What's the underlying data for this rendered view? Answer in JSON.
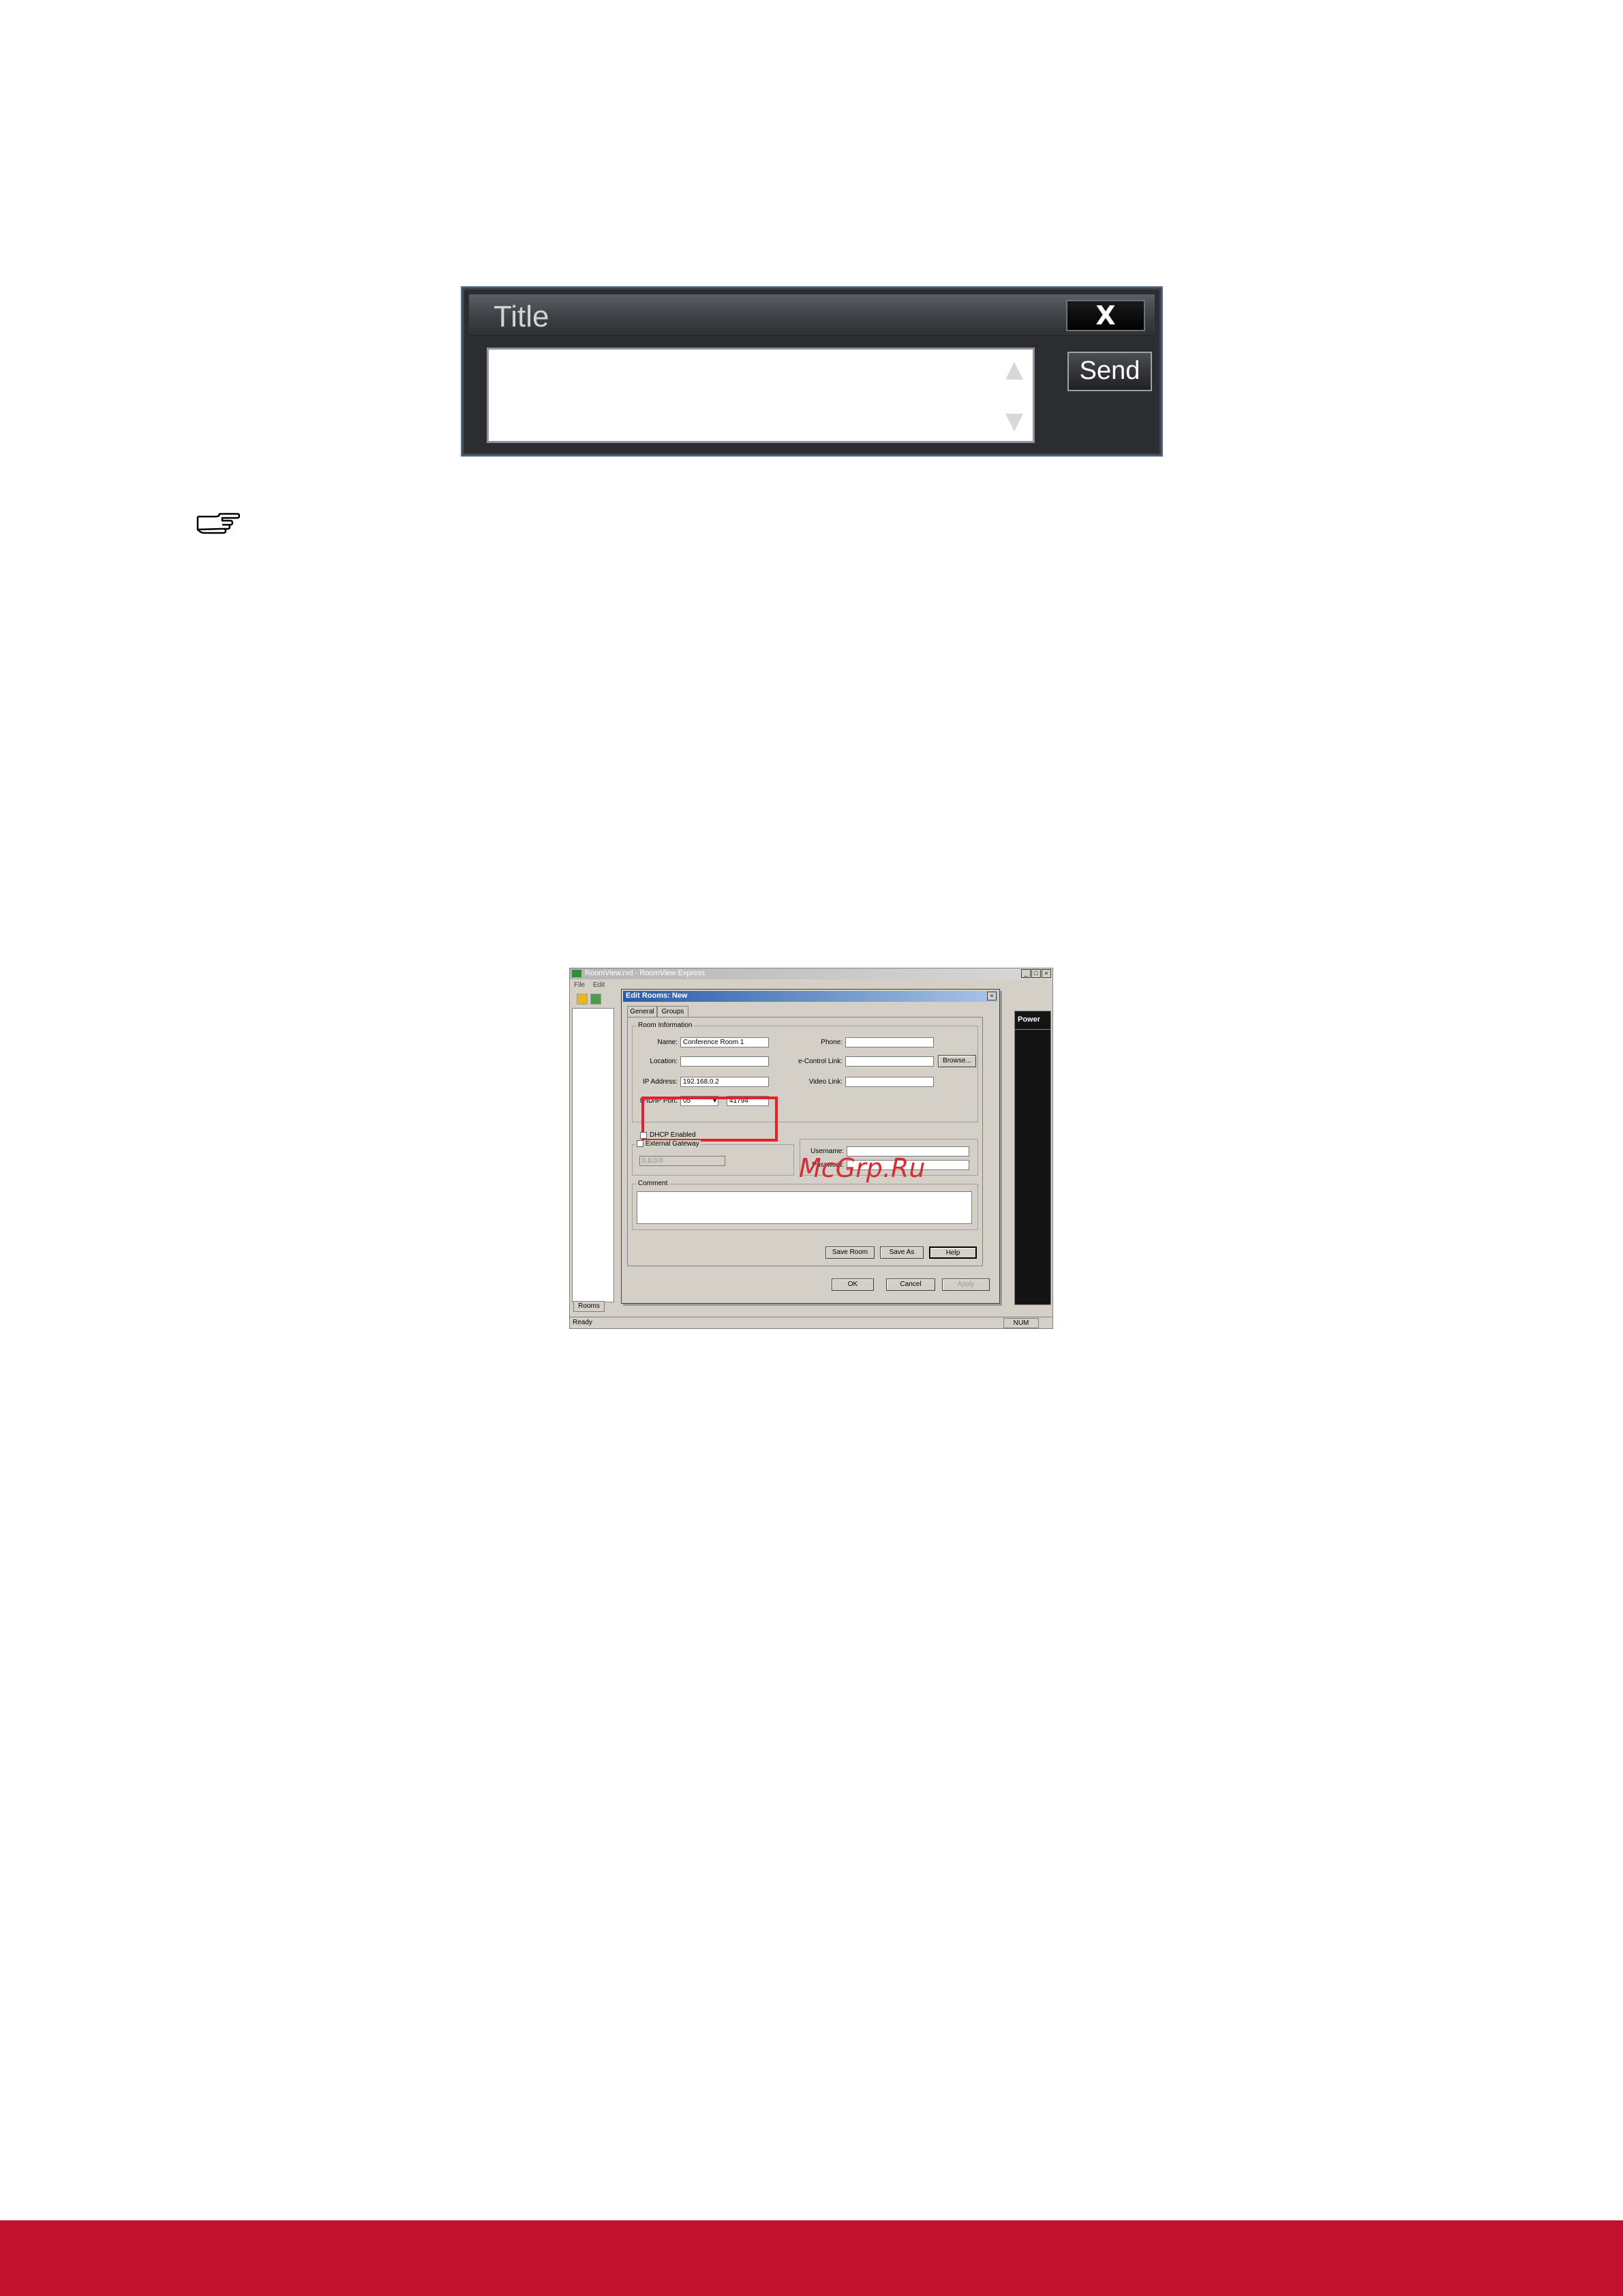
{
  "message_widget": {
    "title": "Title",
    "close_label": "X",
    "send_label": "Send"
  },
  "note_icon": "pointing-hand-icon",
  "roomview": {
    "window_title": "RoomView.rvd - RoomView Express",
    "menu": [
      "File",
      "Edit"
    ],
    "right_header": "Power",
    "rooms_tab": "Rooms",
    "status_ready": "Ready",
    "status_num": "NUM",
    "dialog": {
      "title": "Edit Rooms: New",
      "close_label": "×",
      "tabs": [
        "General",
        "Groups"
      ],
      "room_info_legend": "Room Information",
      "name_label": "Name:",
      "name_value": "Conference Room 1",
      "location_label": "Location:",
      "location_value": "",
      "ip_label": "IP Address:",
      "ip_value": "192.168.0.2",
      "ipid_label": "IPID/IP Port:",
      "ipid_value": "05",
      "port_value": "41794",
      "phone_label": "Phone:",
      "econtrol_label": "e-Control Link:",
      "video_label": "Video Link:",
      "browse_label": "Browse...",
      "dhcp_label": "DHCP Enabled",
      "gateway_label": "External Gateway",
      "gateway_value": "0.0.0.0",
      "username_label": "Username:",
      "password_label": "Password:",
      "comment_legend": "Comment",
      "save_room_label": "Save Room",
      "save_as_label": "Save As",
      "help_label": "Help",
      "ok_label": "OK",
      "cancel_label": "Cancel",
      "apply_label": "Apply"
    },
    "watermark": "McGrp.Ru"
  },
  "colors": {
    "footer": "#c2102f",
    "highlight": "#e3202b"
  }
}
